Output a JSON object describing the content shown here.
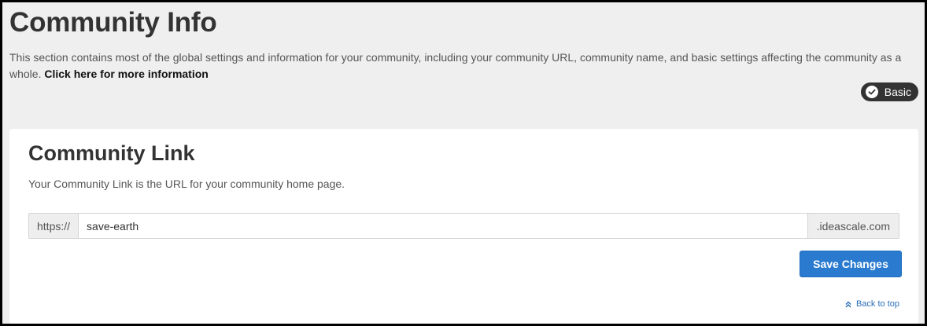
{
  "header": {
    "title": "Community Info",
    "description": "This section contains most of the global settings and information for your community, including your community URL, community name, and basic settings affecting the community as a whole.",
    "more_link": "Click here for more information"
  },
  "badge": {
    "label": "Basic",
    "icon": "check-circle-icon"
  },
  "community_link": {
    "title": "Community Link",
    "description": "Your Community Link is the URL for your community home page.",
    "prefix": "https://",
    "value": "save-earth",
    "suffix": ".ideascale.com",
    "save_label": "Save Changes",
    "back_to_top": "Back to top"
  },
  "colors": {
    "background": "#efefef",
    "card": "#ffffff",
    "primary_button": "#2a7bd0",
    "badge": "#333333",
    "link": "#2a6fb8"
  }
}
